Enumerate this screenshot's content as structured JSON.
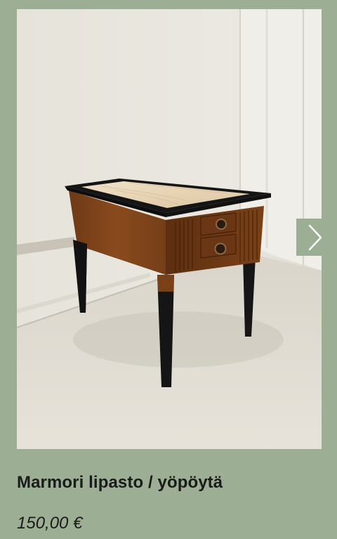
{
  "product": {
    "title": "Marmori lipasto / yöpöytä",
    "price": "150,00 €"
  },
  "carousel": {
    "next_icon": "chevron-right-icon"
  },
  "colors": {
    "background": "#9cae93",
    "text": "#1b1b1b",
    "button_icon": "#ffffff"
  }
}
